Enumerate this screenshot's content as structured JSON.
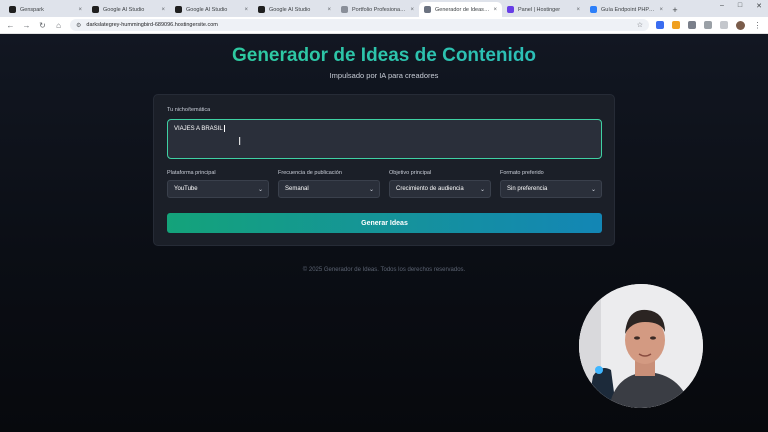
{
  "browser": {
    "tabs": [
      {
        "label": "Genspark",
        "color": "#1f1f1f",
        "active": false
      },
      {
        "label": "Google AI Studio",
        "color": "#1f1f1f",
        "active": false
      },
      {
        "label": "Google AI Studio",
        "color": "#1f1f1f",
        "active": false
      },
      {
        "label": "Google AI Studio",
        "color": "#1f1f1f",
        "active": false
      },
      {
        "label": "Portfolio Profesional | R...",
        "color": "#8a8f99",
        "active": false
      },
      {
        "label": "Generador de Ideas de C...",
        "color": "#6b7280",
        "active": true
      },
      {
        "label": "Panel | Hostinger",
        "color": "#673de6",
        "active": false
      },
      {
        "label": "Guía Endpoint PHP - RC...",
        "color": "#2d7ff9",
        "active": false
      }
    ],
    "url": "darkslategrey-hummingbird-689096.hostingersite.com"
  },
  "header": {
    "title": "Generador de Ideas de Contenido",
    "subtitle": "Impulsado por IA para creadores"
  },
  "form": {
    "niche_label": "Tu nicho/temática",
    "niche_value": "VIAJES A BRASIL",
    "platform_label": "Plataforma principal",
    "platform_value": "YouTube",
    "frequency_label": "Frecuencia de publicación",
    "frequency_value": "Semanal",
    "goal_label": "Objetivo principal",
    "goal_value": "Crecimiento de audiencia",
    "format_label": "Formato preferido",
    "format_value": "Sin preferencia",
    "submit_label": "Generar Ideas"
  },
  "footer": {
    "text": "© 2025 Generador de Ideas. Todos los derechos reservados."
  },
  "colors": {
    "accent_start": "#2fd28f",
    "accent_end": "#2bb6c8",
    "background": "#0b0d12"
  }
}
